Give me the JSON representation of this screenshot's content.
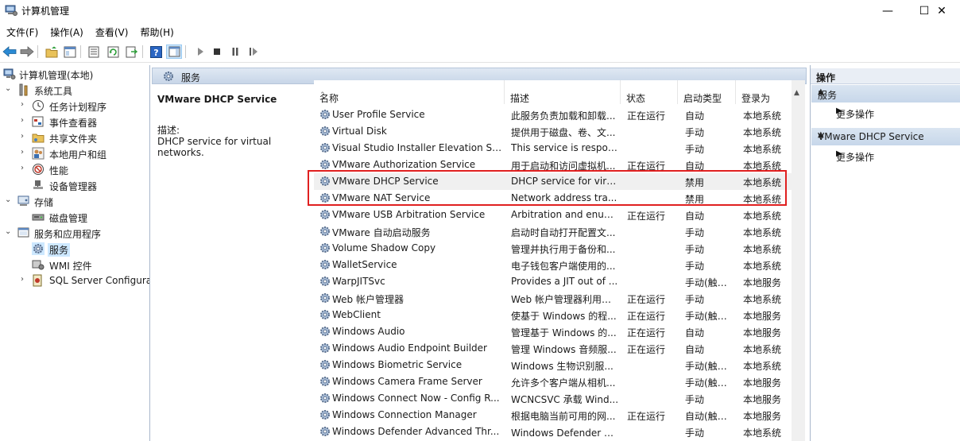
{
  "window": {
    "title": "计算机管理",
    "min_glyph": "—",
    "max_glyph": "☐",
    "close_glyph": "✕"
  },
  "menu": [
    "文件(F)",
    "操作(A)",
    "查看(V)",
    "帮助(H)"
  ],
  "tree": {
    "root": "计算机管理(本地)",
    "system_tools": "系统工具",
    "task_scheduler": "任务计划程序",
    "event_viewer": "事件查看器",
    "shared_folders": "共享文件夹",
    "local_users": "本地用户和组",
    "performance": "性能",
    "device_manager": "设备管理器",
    "storage": "存储",
    "disk_management": "磁盘管理",
    "services_apps": "服务和应用程序",
    "services": "服务",
    "wmi": "WMI 控件",
    "sql": "SQL Server Configura"
  },
  "panel": {
    "header": "服务",
    "selected_service": "VMware DHCP Service",
    "desc_label": "描述:",
    "desc_text": "DHCP service for virtual networks."
  },
  "columns": {
    "name": "名称",
    "description": "描述",
    "status": "状态",
    "startup": "启动类型",
    "logon": "登录为"
  },
  "services": [
    {
      "name": "User Profile Service",
      "desc": "此服务负责加载和卸载...",
      "status": "正在运行",
      "startup": "自动",
      "logon": "本地系统"
    },
    {
      "name": "Virtual Disk",
      "desc": "提供用于磁盘、卷、文...",
      "status": "",
      "startup": "手动",
      "logon": "本地系统"
    },
    {
      "name": "Visual Studio Installer Elevation Se...",
      "desc": "This service is respon...",
      "status": "",
      "startup": "手动",
      "logon": "本地系统"
    },
    {
      "name": "VMware Authorization Service",
      "desc": "用于启动和访问虚拟机...",
      "status": "正在运行",
      "startup": "自动",
      "logon": "本地系统"
    },
    {
      "name": "VMware DHCP Service",
      "desc": "DHCP service for virtu...",
      "status": "",
      "startup": "禁用",
      "logon": "本地系统"
    },
    {
      "name": "VMware NAT Service",
      "desc": "Network address tra...",
      "status": "",
      "startup": "禁用",
      "logon": "本地系统"
    },
    {
      "name": "VMware USB Arbitration Service",
      "desc": "Arbitration and enum...",
      "status": "正在运行",
      "startup": "自动",
      "logon": "本地系统"
    },
    {
      "name": "VMware 自动启动服务",
      "desc": "启动时自动打开配置文...",
      "status": "",
      "startup": "手动",
      "logon": "本地系统"
    },
    {
      "name": "Volume Shadow Copy",
      "desc": "管理并执行用于备份和...",
      "status": "",
      "startup": "手动",
      "logon": "本地系统"
    },
    {
      "name": "WalletService",
      "desc": "电子钱包客户端使用的...",
      "status": "",
      "startup": "手动",
      "logon": "本地系统"
    },
    {
      "name": "WarpJITSvc",
      "desc": "Provides a JIT out of ...",
      "status": "",
      "startup": "手动(触发...",
      "logon": "本地服务"
    },
    {
      "name": "Web 帐户管理器",
      "desc": "Web 帐户管理器利用此...",
      "status": "正在运行",
      "startup": "手动",
      "logon": "本地系统"
    },
    {
      "name": "WebClient",
      "desc": "使基于 Windows 的程...",
      "status": "正在运行",
      "startup": "手动(触发...",
      "logon": "本地服务"
    },
    {
      "name": "Windows Audio",
      "desc": "管理基于 Windows 的...",
      "status": "正在运行",
      "startup": "自动",
      "logon": "本地服务"
    },
    {
      "name": "Windows Audio Endpoint Builder",
      "desc": "管理 Windows 音频服...",
      "status": "正在运行",
      "startup": "自动",
      "logon": "本地系统"
    },
    {
      "name": "Windows Biometric Service",
      "desc": "Windows 生物识别服...",
      "status": "",
      "startup": "手动(触发...",
      "logon": "本地系统"
    },
    {
      "name": "Windows Camera Frame Server",
      "desc": "允许多个客户端从相机...",
      "status": "",
      "startup": "手动(触发...",
      "logon": "本地服务"
    },
    {
      "name": "Windows Connect Now - Config R...",
      "desc": "WCNCSVC 承载 Wind...",
      "status": "",
      "startup": "手动",
      "logon": "本地服务"
    },
    {
      "name": "Windows Connection Manager",
      "desc": "根据电脑当前可用的网...",
      "status": "正在运行",
      "startup": "自动(触发...",
      "logon": "本地服务"
    },
    {
      "name": "Windows Defender Advanced Thr...",
      "desc": "Windows Defender 高...",
      "status": "",
      "startup": "手动",
      "logon": "本地系统"
    }
  ],
  "actions": {
    "header": "操作",
    "section1": "服务",
    "more1": "更多操作",
    "section2": "VMware DHCP Service",
    "more2": "更多操作"
  }
}
